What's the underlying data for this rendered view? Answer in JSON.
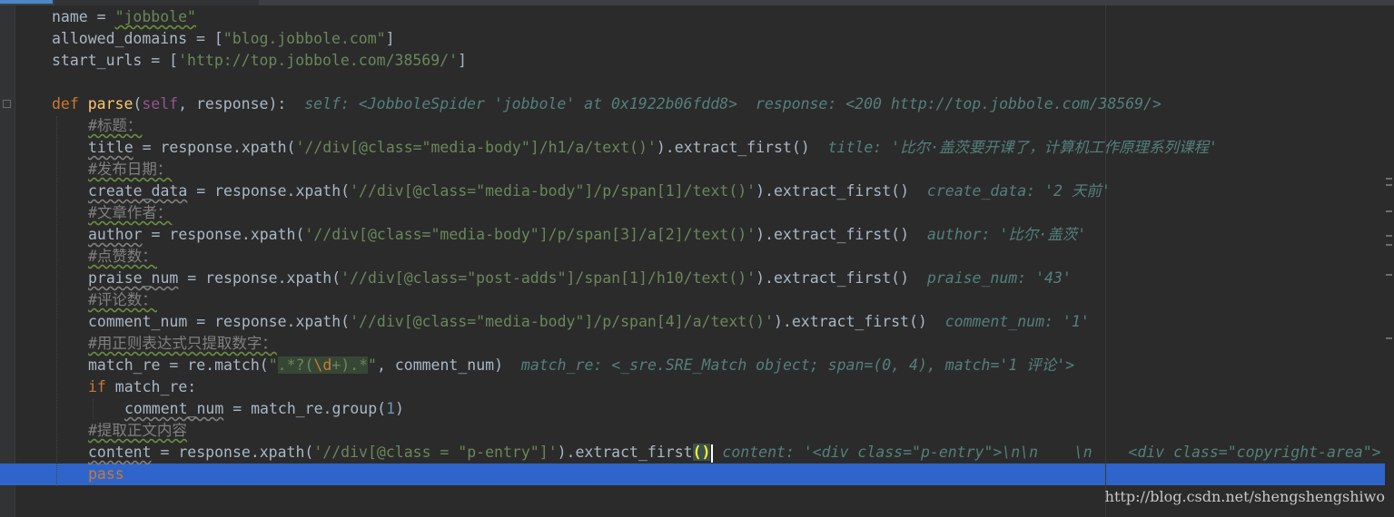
{
  "editor": {
    "lines": {
      "l1": {
        "var": "name",
        "eq": " = ",
        "str": "\"jobbole\""
      },
      "l2": {
        "var": "allowed_domains",
        "eq": " = [",
        "str": "\"blog.jobbole.com\"",
        "end": "]"
      },
      "l3": {
        "var": "start_urls",
        "eq": " = [",
        "str": "'http://top.jobbole.com/38569/'",
        "end": "]"
      },
      "l5": {
        "kw": "def ",
        "fn": "parse",
        "open": "(",
        "self": "self",
        "rest": ", response):",
        "hint": "self: <JobboleSpider 'jobbole' at 0x1922b06fdd8>  response: <200 http://top.jobbole.com/38569/>"
      },
      "l6": {
        "comment": "#标题："
      },
      "l7": {
        "var": "title",
        "code1": " = response.xpath(",
        "str": "'//div[@class=\"media-body\"]/h1/a/text()'",
        "code2": ").extract_first()",
        "hint": "title: '比尔·盖茨要开课了，计算机工作原理系列课程'"
      },
      "l8": {
        "comment": "#发布日期："
      },
      "l9": {
        "var": "create_data",
        "code1": " = response.xpath(",
        "str": "'//div[@class=\"media-body\"]/p/span[1]/text()'",
        "code2": ").extract_first()",
        "hint": "create_data: '2 天前'"
      },
      "l10": {
        "comment": "#文章作者："
      },
      "l11": {
        "var": "author",
        "code1": " = response.xpath(",
        "str": "'//div[@class=\"media-body\"]/p/span[3]/a[2]/text()'",
        "code2": ").extract_first()",
        "hint": "author: '比尔·盖茨'"
      },
      "l12": {
        "comment": "#点赞数："
      },
      "l13": {
        "var": "praise_num",
        "code1": " = response.xpath(",
        "str": "'//div[@class=\"post-adds\"]/span[1]/h10/text()'",
        "code2": ").extract_first()",
        "hint": "praise_num: '43'"
      },
      "l14": {
        "comment": "#评论数："
      },
      "l15": {
        "var": "comment_num",
        "code1": " = response.xpath(",
        "str": "'//div[@class=\"media-body\"]/p/span[4]/a/text()'",
        "code2": ").extract_first()",
        "hint": "comment_num: '1'"
      },
      "l16": {
        "comment": "#用正则表达式只提取数字："
      },
      "l17": {
        "var": "match_re",
        "code1": " = re.match(",
        "str_open": "\"",
        "re1": ".*?(",
        "re_esc": "\\d",
        "re2": "+).*",
        "str_close": "\"",
        "code2": ", comment_num)",
        "hint": "match_re: <_sre.SRE_Match object; span=(0, 4), match='1 评论'>"
      },
      "l18": {
        "kw": "if",
        "rest": " match_re:"
      },
      "l19": {
        "var": "comment_num",
        "code1": " = match_re.group(",
        "num": "1",
        "code2": ")"
      },
      "l20": {
        "comment": "#提取正文内容"
      },
      "l21": {
        "var": "content",
        "code1": " = response.xpath(",
        "str": "'//div[@class = \"p-entry\"]'",
        "code2": ").extract_first",
        "parens": "()",
        "hint": "content: '<div class=\"p-entry\">\\n\\n    \\n    <div class=\"copyright-area\">"
      },
      "l22": {
        "kw": "pass"
      }
    },
    "watermark": "http://blog.csdn.net/shengshengshiwo"
  }
}
